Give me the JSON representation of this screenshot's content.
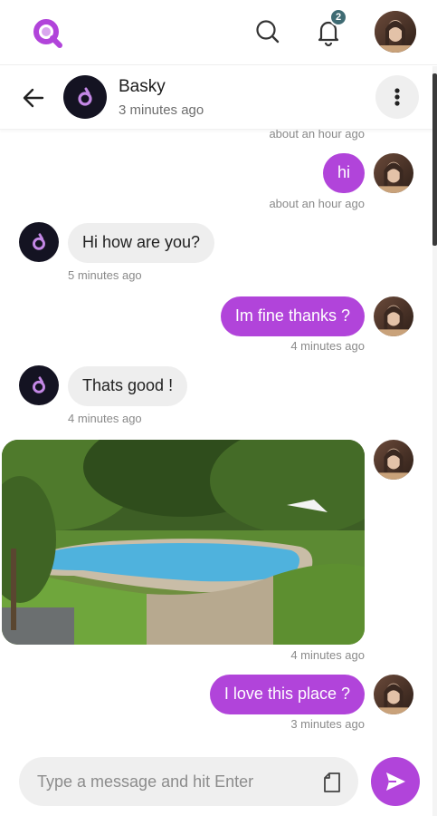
{
  "topbar": {
    "notification_count": "2"
  },
  "chat_header": {
    "name": "Basky",
    "status": "3 minutes ago"
  },
  "messages": [
    {
      "from": "me",
      "text": "",
      "time": "about an hour ago"
    },
    {
      "from": "me",
      "text": "hi",
      "time": "about an hour ago"
    },
    {
      "from": "them",
      "text": "Hi how are you?",
      "time": "5 minutes ago"
    },
    {
      "from": "me",
      "text": "Im fine thanks ?",
      "time": "4 minutes ago"
    },
    {
      "from": "them",
      "text": "Thats good !",
      "time": "4 minutes ago"
    },
    {
      "from": "me",
      "type": "image",
      "image_subject": "backyard swimming pool",
      "time": "4 minutes ago"
    },
    {
      "from": "me",
      "text": "I love this place ?",
      "time": "3 minutes ago"
    }
  ],
  "composer": {
    "placeholder": "Type a message and hit Enter"
  },
  "icons": {
    "logo": "app-logo-icon",
    "search": "search-icon",
    "notifications": "bell-icon",
    "back": "arrow-left-icon",
    "more": "more-vertical-icon",
    "attach": "file-icon",
    "send": "send-icon"
  },
  "colors": {
    "accent": "#b144da",
    "badge": "#3f6b73",
    "incoming_bubble": "#eeeeee",
    "contact_avatar_bg": "#141322"
  }
}
